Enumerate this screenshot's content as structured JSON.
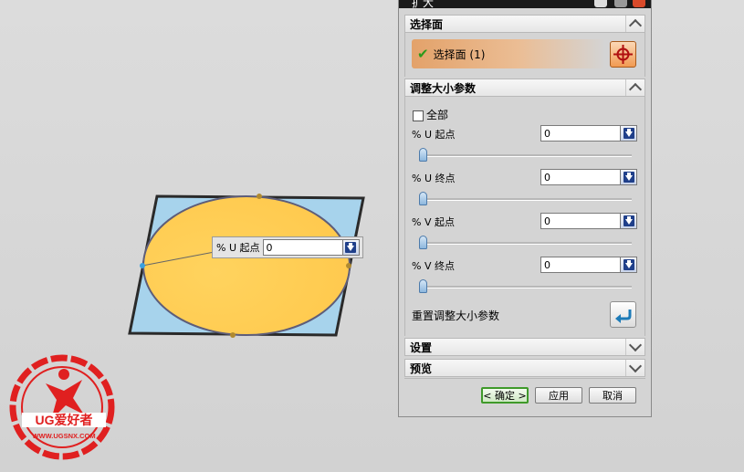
{
  "dialog": {
    "title": "扩大",
    "sections": {
      "select_face": {
        "header": "选择面",
        "row_label": "选择面 (1)",
        "check_icon": "checkmark-icon",
        "pick_icon": "crosshair-icon"
      },
      "resize_params": {
        "header": "调整大小参数",
        "all_label": "全部",
        "params": [
          {
            "label": "% U 起点",
            "value": "0",
            "slider_value": 0
          },
          {
            "label": "% U 终点",
            "value": "0",
            "slider_value": 0
          },
          {
            "label": "% V 起点",
            "value": "0",
            "slider_value": 0
          },
          {
            "label": "% V 终点",
            "value": "0",
            "slider_value": 0
          }
        ],
        "reset_label": "重置调整大小参数"
      },
      "settings": {
        "header": "设置"
      },
      "preview": {
        "header": "预览"
      }
    },
    "buttons": {
      "ok": "< 确定 >",
      "apply": "应用",
      "cancel": "取消"
    }
  },
  "viewport": {
    "inline_label": "% U 起点",
    "inline_value": "0",
    "colors": {
      "plane": "#a7d3ec",
      "face": "#ffcf55",
      "edge": "#333333"
    }
  },
  "logo": {
    "text": "UG爱好者",
    "url": "WWW.UGSNX.COM",
    "color": "#e02020"
  }
}
